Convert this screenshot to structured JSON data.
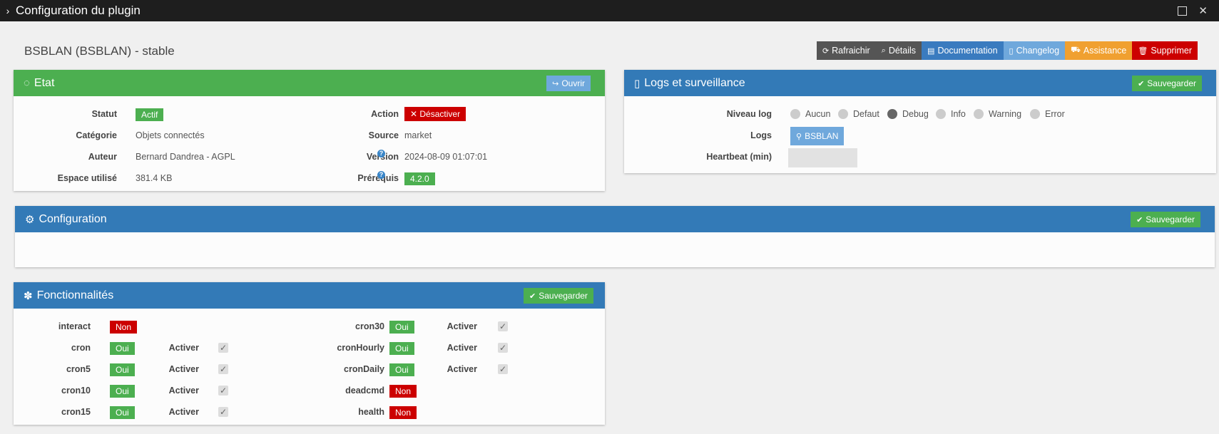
{
  "window": {
    "title": "Configuration du plugin"
  },
  "plugin_title": "BSBLAN (BSBLAN) - stable",
  "toolbar": [
    {
      "label": "Rafraichir",
      "icon": "refresh-icon",
      "color": "#555555"
    },
    {
      "label": "Détails",
      "icon": "search-icon",
      "color": "#555555"
    },
    {
      "label": "Documentation",
      "icon": "book-icon",
      "color": "#3a7bbf"
    },
    {
      "label": "Changelog",
      "icon": "file-icon",
      "color": "#6fa8dc"
    },
    {
      "label": "Assistance",
      "icon": "ambulance-icon",
      "color": "#f0a030"
    },
    {
      "label": "Supprimer",
      "icon": "trash-icon",
      "color": "#cc0000"
    }
  ],
  "etat": {
    "title": "Etat",
    "open_label": "Ouvrir",
    "rows_left": [
      {
        "label": "Statut",
        "value": "Actif",
        "kind": "green"
      },
      {
        "label": "Catégorie",
        "value": "Objets connectés"
      },
      {
        "label": "Auteur",
        "value": "Bernard Dandrea - AGPL"
      },
      {
        "label": "Espace utilisé",
        "value": "381.4 KB"
      }
    ],
    "rows_right": [
      {
        "label": "Action",
        "value": "Désactiver",
        "kind": "red"
      },
      {
        "label": "Source",
        "value": "market"
      },
      {
        "label": "Version",
        "value": "2024-08-09 01:07:01"
      },
      {
        "label": "Prérequis",
        "value": "4.2.0",
        "kind": "green"
      }
    ]
  },
  "logs": {
    "title": "Logs et surveillance",
    "save_label": "Sauvegarder",
    "niveau_label": "Niveau log",
    "levels": [
      "Aucun",
      "Defaut",
      "Debug",
      "Info",
      "Warning",
      "Error"
    ],
    "selected_level": "Debug",
    "logs_label": "Logs",
    "logs_button": "BSBLAN",
    "heartbeat_label": "Heartbeat (min)",
    "heartbeat_value": ""
  },
  "configuration": {
    "title": "Configuration",
    "save_label": "Sauvegarder"
  },
  "fonctionnalites": {
    "title": "Fonctionnalités",
    "save_label": "Sauvegarder",
    "activer_label": "Activer",
    "left": [
      {
        "name": "interact",
        "status": "Non",
        "ok": false,
        "activer": false
      },
      {
        "name": "cron",
        "status": "Oui",
        "ok": true,
        "activer": true
      },
      {
        "name": "cron5",
        "status": "Oui",
        "ok": true,
        "activer": true
      },
      {
        "name": "cron10",
        "status": "Oui",
        "ok": true,
        "activer": true
      },
      {
        "name": "cron15",
        "status": "Oui",
        "ok": true,
        "activer": true
      }
    ],
    "right": [
      {
        "name": "cron30",
        "status": "Oui",
        "ok": true,
        "activer": true
      },
      {
        "name": "cronHourly",
        "status": "Oui",
        "ok": true,
        "activer": true
      },
      {
        "name": "cronDaily",
        "status": "Oui",
        "ok": true,
        "activer": true
      },
      {
        "name": "deadcmd",
        "status": "Non",
        "ok": false,
        "activer": false
      },
      {
        "name": "health",
        "status": "Non",
        "ok": false,
        "activer": false
      }
    ]
  },
  "colors": {
    "green": "#4caf50",
    "blue": "#337ab7",
    "red": "#cc0000",
    "lightblue": "#6fa8dc"
  }
}
